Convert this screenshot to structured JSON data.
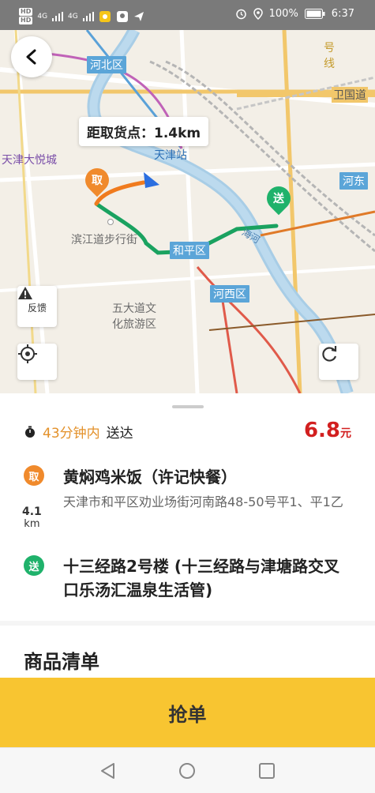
{
  "status_bar": {
    "left_badge_1": "HD",
    "left_badge_2": "HD",
    "signal_1": "4G",
    "signal_2": "4G",
    "battery": "100%",
    "time": "6:37"
  },
  "map": {
    "labels": {
      "hebei": "河北区",
      "heping": "和平区",
      "hexi": "河西区",
      "hedong": "河东",
      "tianjin_station": "天津站",
      "joy_city": "天津大悦城",
      "binjiang": "滨江道步行街",
      "wudadao_1": "五大道文",
      "wudadao_2": "化旅游区",
      "metro_line_9": "号",
      "metro_line_9b": "线",
      "weiguo": "卫国道",
      "haihe": "海河"
    },
    "tooltip": "距取货点：1.4km",
    "pickup_pin": "取",
    "dropoff_pin": "送",
    "feedback_label": "反馈"
  },
  "order": {
    "time_limit": "43分钟内",
    "time_suffix": "送达",
    "price": "6.8",
    "price_unit": "元",
    "pickup_badge": "取",
    "pickup_name": "黄焖鸡米饭（许记快餐）",
    "pickup_address": "天津市和平区劝业场街河南路48-50号平1、平1乙",
    "distance_value": "4.1",
    "distance_unit": "km",
    "dropoff_badge": "送",
    "dropoff_address": "十三经路2号楼 (十三经路与津塘路交叉口乐汤汇温泉生活管)"
  },
  "goods_title": "商品清单",
  "grab_button": "抢单",
  "colors": {
    "accent_yellow": "#f8c531",
    "pickup_orange": "#f08a2c",
    "dropoff_green": "#1fb26b",
    "price_red": "#d21f1f",
    "route_green": "#1aa260",
    "route_orange": "#f07b1e",
    "district_blue": "#5ba5d8"
  },
  "icons": [
    "back-arrow-icon",
    "warning-icon",
    "locate-icon",
    "refresh-icon",
    "timer-icon",
    "nav-back-icon",
    "nav-home-icon",
    "nav-recent-icon"
  ]
}
